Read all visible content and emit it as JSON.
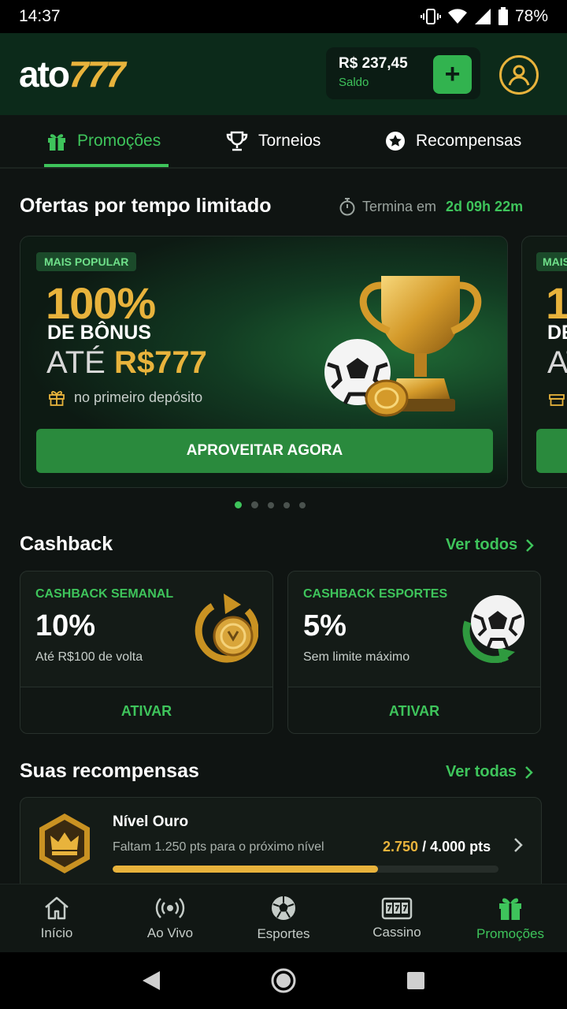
{
  "status": {
    "time": "14:37",
    "battery": "78%"
  },
  "header": {
    "logo_main": "ato",
    "logo_accent": "777",
    "balance_amount": "R$ 237,45",
    "balance_label": "Saldo",
    "add_label": "+"
  },
  "tabs": [
    {
      "label": "Promoções",
      "icon": "gift-icon",
      "active": true
    },
    {
      "label": "Torneios",
      "icon": "trophy-icon",
      "active": false
    },
    {
      "label": "Recompensas",
      "icon": "star-badge-icon",
      "active": false
    }
  ],
  "offers": {
    "title": "Ofertas por tempo limitado",
    "timer_label": "Termina em",
    "timer_value": "2d 09h 22m",
    "card": {
      "badge": "MAIS POPULAR",
      "percent": "100%",
      "line2": "DE BÔNUS",
      "line3_prefix": "ATÉ",
      "line3_amount": "R$777",
      "note": "no primeiro depósito",
      "cta": "APROVEITAR AGORA"
    },
    "peek": {
      "badge": "MAIS",
      "percent": "1",
      "line2": "DE",
      "line3": "AT"
    },
    "carousel_count": 5,
    "carousel_active": 1
  },
  "cashback": {
    "title": "Cashback",
    "see_all": "Ver todos",
    "cards": [
      {
        "title": "CASHBACK SEMANAL",
        "percent": "10%",
        "subtitle": "Até R$100 de volta",
        "button": "ATIVAR",
        "icon": "coin-refresh-icon"
      },
      {
        "title": "CASHBACK ESPORTES",
        "percent": "5%",
        "subtitle": "Sem limite máximo",
        "button": "ATIVAR",
        "icon": "soccer-ball-refresh-icon"
      }
    ]
  },
  "rewards": {
    "title": "Suas recompensas",
    "see_all": "Ver todas",
    "level_name": "Nível Ouro",
    "level_desc": "Faltam 1.250 pts para o próximo nível",
    "points_current": "2.750",
    "points_target": "/ 4.000 pts",
    "progress_fraction": 0.6875
  },
  "bottom_nav": [
    {
      "label": "Início",
      "icon": "home-icon",
      "active": false
    },
    {
      "label": "Ao Vivo",
      "icon": "live-broadcast-icon",
      "active": false
    },
    {
      "label": "Esportes",
      "icon": "soccer-ball-icon",
      "active": false
    },
    {
      "label": "Cassino",
      "icon": "slot-machine-icon",
      "active": false
    },
    {
      "label": "Promoções",
      "icon": "gift-icon",
      "active": true
    }
  ],
  "colors": {
    "accent": "#3ec45b",
    "gold": "#e8b33c",
    "background": "#0f1412",
    "header": "#0c2a1a"
  }
}
